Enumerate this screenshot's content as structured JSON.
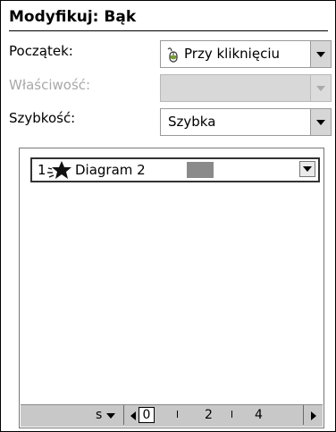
{
  "pane": {
    "title": "Modyfikuj: Bąk"
  },
  "fields": {
    "start": {
      "label": "Początek:",
      "value": "Przy kliknięciu",
      "icon": "mouse-icon"
    },
    "property": {
      "label": "Właściwość:",
      "value": "",
      "disabled": true
    },
    "speed": {
      "label": "Szybkość:",
      "value": "Szybka"
    }
  },
  "animation_list": [
    {
      "index": "1",
      "icon": "spin-star-icon",
      "name": "Diagram 2",
      "swatch_color": "#8a8a8a"
    }
  ],
  "timeline": {
    "unit_label": "s",
    "ticks": [
      "0",
      "2",
      "4"
    ]
  }
}
